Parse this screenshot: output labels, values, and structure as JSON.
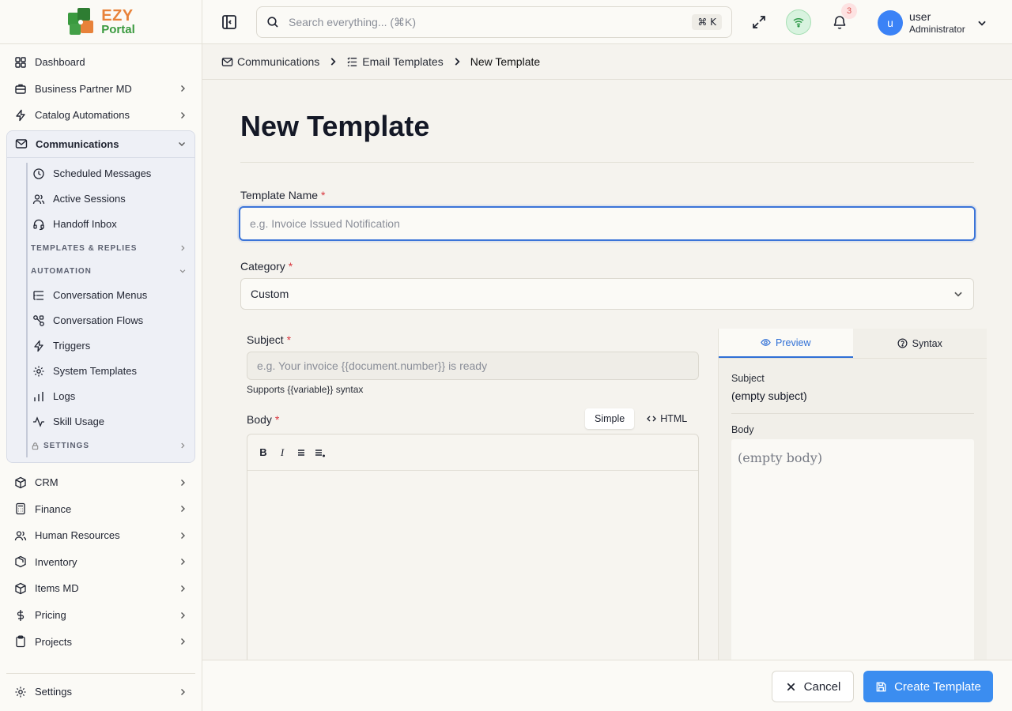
{
  "app": {
    "logo_primary": "EZY",
    "logo_secondary": "Portal"
  },
  "sidebar": {
    "items_top": [
      {
        "label": "Dashboard",
        "icon": "grid-icon",
        "has_chevron": false
      },
      {
        "label": "Business Partner MD",
        "icon": "briefcase-icon",
        "has_chevron": true
      },
      {
        "label": "Catalog Automations",
        "icon": "zap-icon",
        "has_chevron": true
      }
    ],
    "communications": {
      "label": "Communications",
      "icon": "mail-icon",
      "children": [
        {
          "label": "Scheduled Messages",
          "icon": "clock-icon"
        },
        {
          "label": "Active Sessions",
          "icon": "users-icon"
        },
        {
          "label": "Handoff Inbox",
          "icon": "headset-icon"
        }
      ],
      "section_templates": "TEMPLATES & REPLIES",
      "section_automation": "AUTOMATION",
      "automation_children": [
        {
          "label": "Conversation Menus",
          "icon": "list-tree-icon"
        },
        {
          "label": "Conversation Flows",
          "icon": "workflow-icon"
        },
        {
          "label": "Triggers",
          "icon": "zap-icon"
        },
        {
          "label": "System Templates",
          "icon": "gear-icon"
        },
        {
          "label": "Logs",
          "icon": "bar-chart-icon"
        },
        {
          "label": "Skill Usage",
          "icon": "activity-icon"
        }
      ],
      "section_settings": "SETTINGS"
    },
    "items_bottom": [
      {
        "label": "CRM",
        "icon": "cube-icon"
      },
      {
        "label": "Finance",
        "icon": "calculator-icon"
      },
      {
        "label": "Human Resources",
        "icon": "users-icon"
      },
      {
        "label": "Inventory",
        "icon": "package-icon"
      },
      {
        "label": "Items MD",
        "icon": "box-icon"
      },
      {
        "label": "Pricing",
        "icon": "dollar-icon"
      },
      {
        "label": "Projects",
        "icon": "clipboard-icon"
      }
    ],
    "settings_label": "Settings"
  },
  "topbar": {
    "search_placeholder": "Search everything... (⌘K)",
    "search_value": "",
    "shortcut": "⌘ K",
    "notification_count": "3",
    "user_initial": "u",
    "user_name": "user",
    "user_role": "Administrator"
  },
  "breadcrumb": {
    "root": "Communications",
    "parent": "Email Templates",
    "current": "New Template"
  },
  "form": {
    "title": "New Template",
    "template_name_label": "Template Name",
    "template_name_placeholder": "e.g. Invoice Issued Notification",
    "template_name_value": "",
    "category_label": "Category",
    "category_value": "Custom",
    "subject_label": "Subject",
    "subject_placeholder": "e.g. Your invoice {{document.number}} is ready",
    "subject_value": "",
    "subject_hint": "Supports {{variable}} syntax",
    "body_label": "Body",
    "mode_simple": "Simple",
    "mode_html": "HTML",
    "toolbar": {
      "bold": "B",
      "italic": "I"
    },
    "required_marker": "*"
  },
  "preview": {
    "tab_preview": "Preview",
    "tab_syntax": "Syntax",
    "subject_label": "Subject",
    "subject_value": "(empty subject)",
    "body_label": "Body",
    "body_value": "(empty body)"
  },
  "footer": {
    "cancel_label": "Cancel",
    "create_label": "Create Template"
  },
  "colors": {
    "primary": "#3b8df0",
    "focus": "#3b74d8",
    "required": "#d9363e",
    "preview_tab": "#2f6fd6"
  }
}
